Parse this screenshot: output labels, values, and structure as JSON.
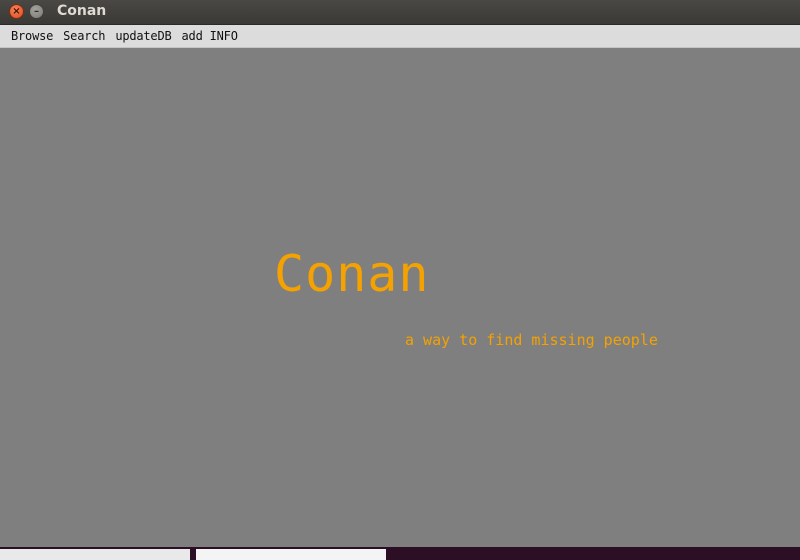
{
  "window": {
    "title": "Conan",
    "close_glyph": "×",
    "minimize_glyph": "–"
  },
  "menubar": {
    "items": [
      {
        "label": "Browse"
      },
      {
        "label": "Search"
      },
      {
        "label": "updateDB"
      },
      {
        "label": "add INFO"
      }
    ]
  },
  "main": {
    "title": "Conan",
    "tagline": "a way to find missing people"
  },
  "colors": {
    "accent": "#f5a200",
    "canvas_background": "#7f7f7f",
    "menubar_background": "#dcdcdc",
    "titlebar_background": "#3a3936"
  },
  "icons": {
    "close": "close-icon",
    "minimize": "minimize-icon"
  }
}
